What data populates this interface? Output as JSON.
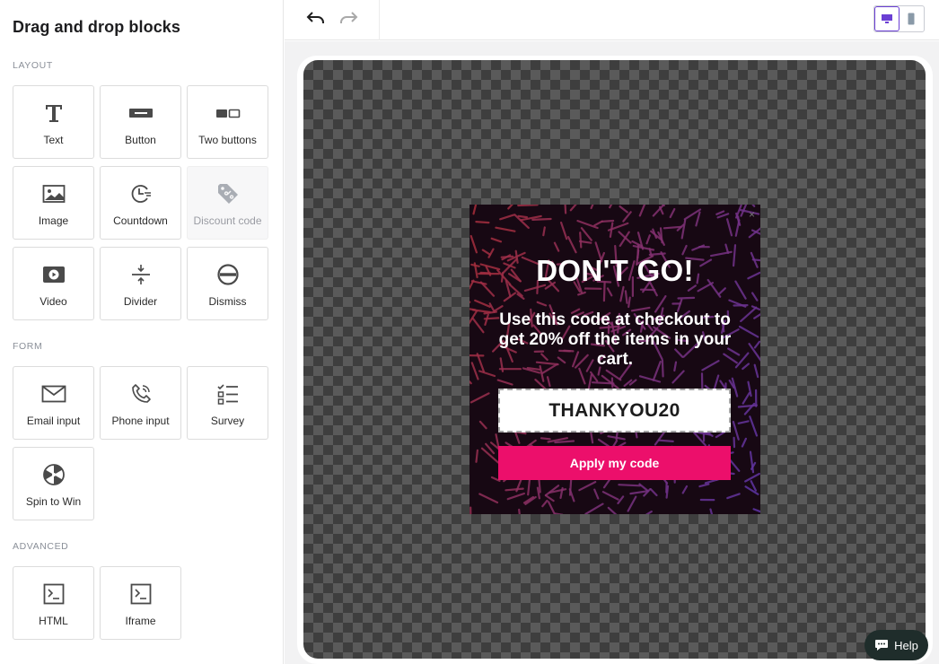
{
  "sidebar": {
    "title": "Drag and drop blocks",
    "sections": {
      "layout": {
        "label": "LAYOUT",
        "blocks": [
          {
            "label": "Text",
            "icon": "text-icon"
          },
          {
            "label": "Button",
            "icon": "button-icon"
          },
          {
            "label": "Two buttons",
            "icon": "two-buttons-icon"
          },
          {
            "label": "Image",
            "icon": "image-icon"
          },
          {
            "label": "Countdown",
            "icon": "countdown-icon"
          },
          {
            "label": "Discount code",
            "icon": "tag-icon",
            "disabled": true
          },
          {
            "label": "Video",
            "icon": "video-icon"
          },
          {
            "label": "Divider",
            "icon": "divider-icon"
          },
          {
            "label": "Dismiss",
            "icon": "dismiss-icon"
          }
        ]
      },
      "form": {
        "label": "FORM",
        "blocks": [
          {
            "label": "Email input",
            "icon": "envelope-icon"
          },
          {
            "label": "Phone input",
            "icon": "phone-icon"
          },
          {
            "label": "Survey",
            "icon": "checklist-icon"
          },
          {
            "label": "Spin to Win",
            "icon": "wheel-icon"
          }
        ]
      },
      "advanced": {
        "label": "ADVANCED",
        "blocks": [
          {
            "label": "HTML",
            "icon": "terminal-icon"
          },
          {
            "label": "Iframe",
            "icon": "terminal-icon"
          }
        ]
      }
    }
  },
  "toolbar": {
    "undo_icon": "undo-icon",
    "redo_icon": "redo-icon",
    "device_selected": "desktop",
    "accent_color": "#6b3fd4"
  },
  "popup": {
    "close_glyph": "×",
    "title": "DON'T GO!",
    "body": "Use this code at checkout to get 20% off the items in your cart.",
    "code": "THANKYOU20",
    "button_label": "Apply my code",
    "button_color": "#ec0f6b"
  },
  "help": {
    "label": "Help",
    "icon": "chat-icon"
  }
}
